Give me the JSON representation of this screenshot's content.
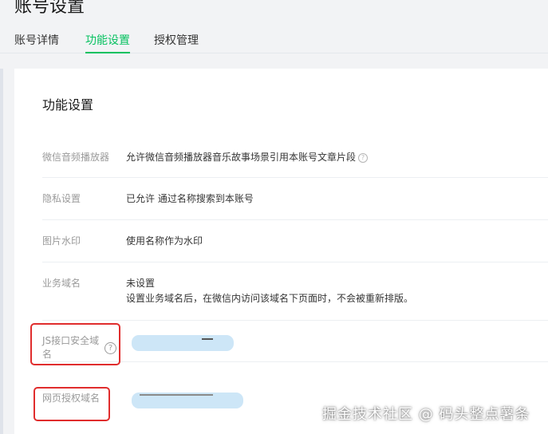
{
  "page": {
    "title": "账号设置"
  },
  "tabs": [
    {
      "label": "账号详情",
      "active": false
    },
    {
      "label": "功能设置",
      "active": true
    },
    {
      "label": "授权管理",
      "active": false
    }
  ],
  "accent_color": "#07c160",
  "annotation_color": "#e02d2d",
  "card": {
    "title": "功能设置",
    "rows": [
      {
        "label": "微信音频播放器",
        "value": "允许微信音频播放器音乐故事场景引用本账号文章片段",
        "help_icon": "question-circle-icon"
      },
      {
        "label": "隐私设置",
        "value": "已允许 通过名称搜索到本账号"
      },
      {
        "label": "图片水印",
        "value": "使用名称作为水印"
      },
      {
        "label": "业务域名",
        "value": "未设置",
        "sub": "设置业务域名后，在微信内访问该域名下页面时，不会被重新排版。"
      },
      {
        "label": "JS接口安全域名",
        "value": "",
        "help_icon": "question-circle-icon"
      },
      {
        "label": "网页授权域名",
        "value": ""
      }
    ]
  },
  "watermark": "掘金技术社区 @ 码头整点薯条"
}
